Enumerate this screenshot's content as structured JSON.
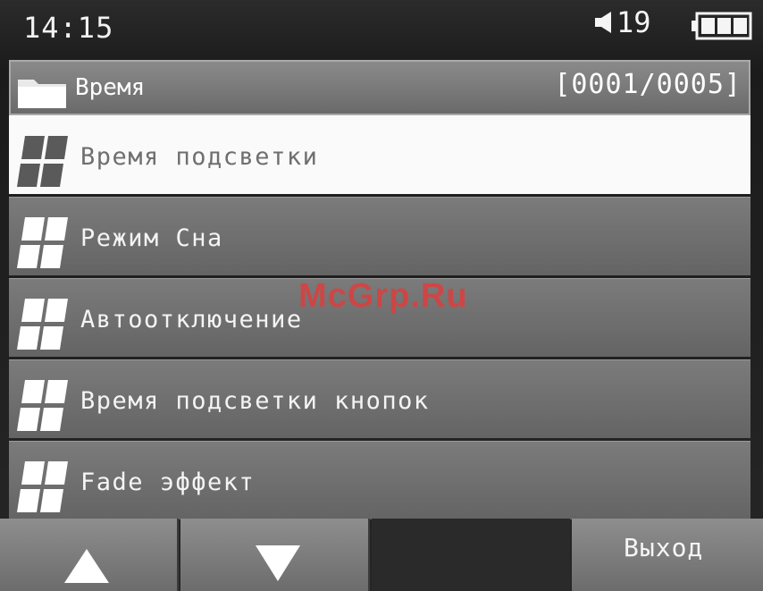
{
  "status": {
    "time": "14:15",
    "volume": "19",
    "volume_icon": "speaker-icon",
    "battery_icon": "battery-full-icon"
  },
  "header": {
    "title": "Время",
    "counter": "[0001/0005]",
    "icon": "folder-icon"
  },
  "menu": {
    "selected_index": 0,
    "items": [
      {
        "label": "Время подсветки"
      },
      {
        "label": "Режим Сна"
      },
      {
        "label": "Автоотключение"
      },
      {
        "label": "Время подсветки кнопок"
      },
      {
        "label": "Fade эффект"
      }
    ]
  },
  "watermark": "McGrp.Ru",
  "softkeys": {
    "up_icon": "triangle-up-icon",
    "down_icon": "triangle-down-icon",
    "exit_label": "Выход"
  },
  "colors": {
    "selected_bg": "#fafafa",
    "item_bg": "#707070",
    "watermark": "#e33b3b"
  }
}
